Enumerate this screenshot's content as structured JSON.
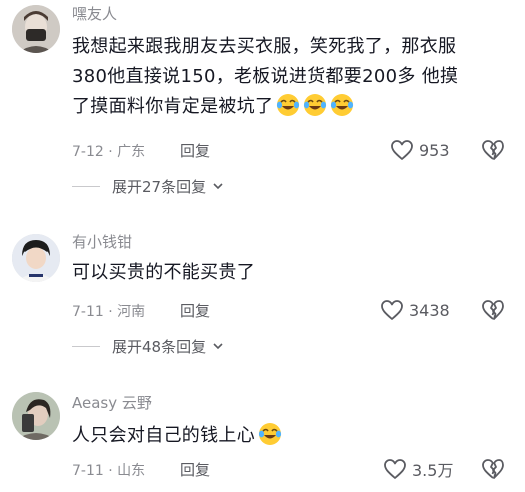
{
  "comments": [
    {
      "username": "嘿友人",
      "lines": [
        "我想起来跟我朋友去买衣服，笑死我了，那衣服",
        "380他直接说150，老板说进货都要200多 他摸",
        "了摸面料你肯定是被坑了"
      ],
      "emoji_count": 3,
      "date": "7-12",
      "location": "广东",
      "reply_label": "回复",
      "likes": "953",
      "expand_label": "展开27条回复"
    },
    {
      "username": "有小钱钳",
      "lines": [
        "可以买贵的不能买贵了"
      ],
      "emoji_count": 0,
      "date": "7-11",
      "location": "河南",
      "reply_label": "回复",
      "likes": "3438",
      "expand_label": "展开48条回复"
    },
    {
      "username": "Aeasy 云野",
      "lines": [
        "人只会对自己的钱上心"
      ],
      "emoji_count": 1,
      "date": "7-11",
      "location": "山东",
      "reply_label": "回复",
      "likes": "3.5万"
    }
  ],
  "icons": {
    "like": "heart-outline-icon",
    "dislike": "broken-heart-icon",
    "emoji": "crying-laughing-emoji-icon",
    "expand": "chevron-down-icon"
  },
  "colors": {
    "text": "#161823",
    "secondary": "#8a8b91",
    "emoji": "#ffcc33"
  }
}
